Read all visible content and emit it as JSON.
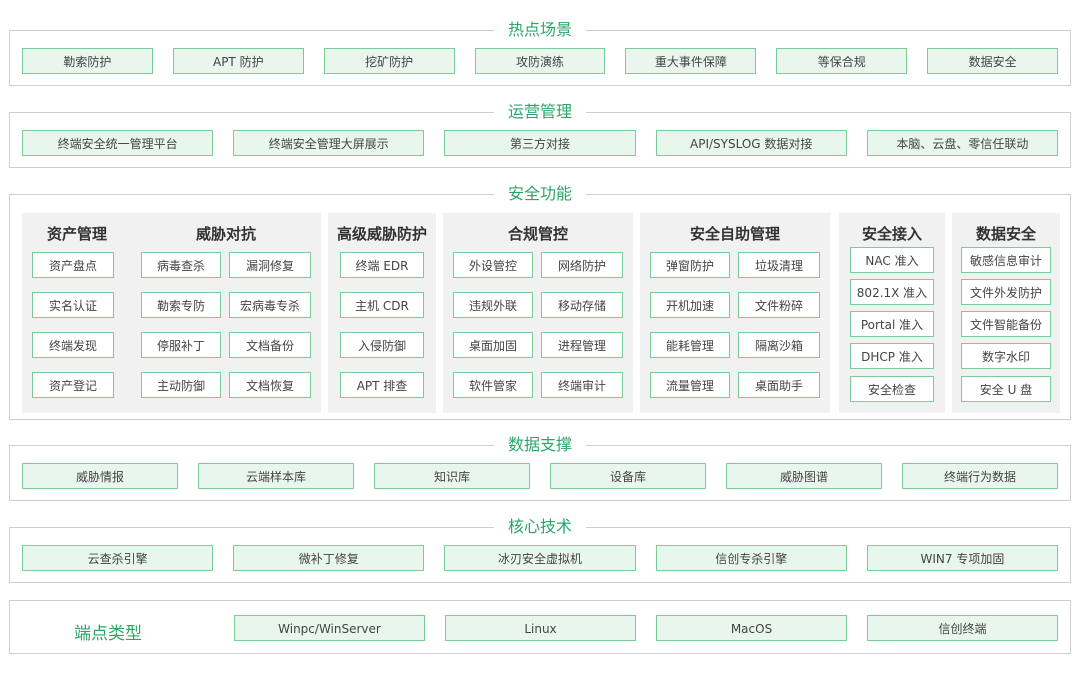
{
  "hot_scenarios": {
    "title": "热点场景",
    "items": [
      "勒索防护",
      "APT 防护",
      "挖矿防护",
      "攻防演练",
      "重大事件保障",
      "等保合规",
      "数据安全"
    ]
  },
  "operations": {
    "title": "运营管理",
    "items": [
      "终端安全统一管理平台",
      "终端安全管理大屏展示",
      "第三方对接",
      "API/SYSLOG 数据对接",
      "本脑、云盘、零信任联动"
    ]
  },
  "security_functions": {
    "title": "安全功能",
    "groups": [
      {
        "title": "资产管理",
        "items": [
          "资产盘点",
          "实名认证",
          "终端发现",
          "资产登记"
        ]
      },
      {
        "title": "威胁对抗",
        "items": [
          "病毒查杀",
          "漏洞修复",
          "勒索专防",
          "宏病毒专杀",
          "停服补丁",
          "文档备份",
          "主动防御",
          "文档恢复"
        ]
      },
      {
        "title": "高级威胁防护",
        "items": [
          "终端 EDR",
          "主机 CDR",
          "入侵防御",
          "APT 排查"
        ]
      },
      {
        "title": "合规管控",
        "items": [
          "外设管控",
          "网络防护",
          "违规外联",
          "移动存储",
          "桌面加固",
          "进程管理",
          "软件管家",
          "终端审计"
        ]
      },
      {
        "title": "安全自助管理",
        "items": [
          "弹窗防护",
          "垃圾清理",
          "开机加速",
          "文件粉碎",
          "能耗管理",
          "隔离沙箱",
          "流量管理",
          "桌面助手"
        ]
      },
      {
        "title": "安全接入",
        "items": [
          "NAC 准入",
          "802.1X 准入",
          "Portal 准入",
          "DHCP 准入",
          "安全检查"
        ]
      },
      {
        "title": "数据安全",
        "items": [
          "敏感信息审计",
          "文件外发防护",
          "文件智能备份",
          "数字水印",
          "安全 U 盘"
        ]
      }
    ]
  },
  "data_support": {
    "title": "数据支撑",
    "items": [
      "威胁情报",
      "云端样本库",
      "知识库",
      "设备库",
      "威胁图谱",
      "终端行为数据"
    ]
  },
  "core_tech": {
    "title": "核心技术",
    "items": [
      "云查杀引擎",
      "微补丁修复",
      "冰刃安全虚拟机",
      "信创专杀引擎",
      "WIN7 专项加固"
    ]
  },
  "endpoints": {
    "label": "端点类型",
    "items": [
      "Winpc/WinServer",
      "Linux",
      "MacOS",
      "信创终端"
    ]
  },
  "colors": {
    "accent": "#2aa768",
    "chip_bg": "#e9f6ee",
    "chip_border": "#7ccb9b"
  }
}
